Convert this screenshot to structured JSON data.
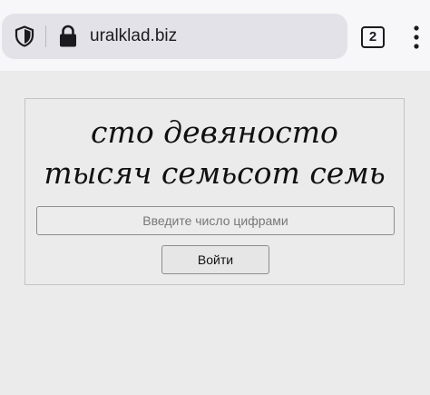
{
  "browser": {
    "url": "uralklad.biz",
    "tab_count": "2",
    "icons": {
      "shield": "shield-icon",
      "lock": "lock-icon",
      "menu": "more-vertical-icon"
    }
  },
  "captcha": {
    "line1": "сто девяносто",
    "line2": "тысяч семьсот семь",
    "input": {
      "value": "",
      "placeholder": "Введите число цифрами"
    },
    "submit_label": "Войти"
  }
}
